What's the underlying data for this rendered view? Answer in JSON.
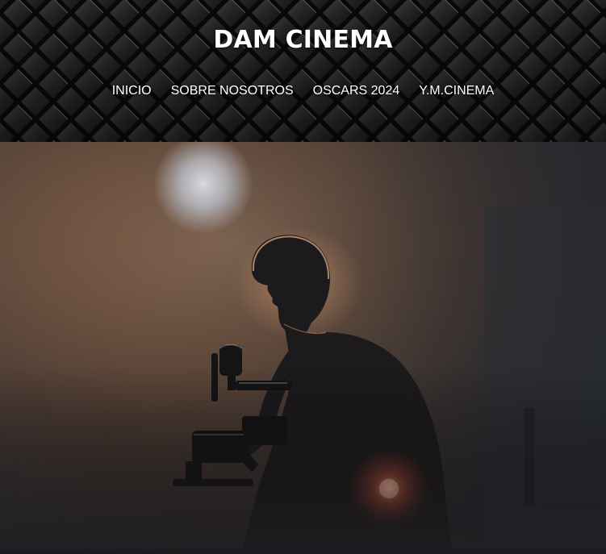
{
  "site": {
    "title": "DAM CINEMA"
  },
  "nav": {
    "items": [
      {
        "label": "INICIO"
      },
      {
        "label": "SOBRE NOSOTROS"
      },
      {
        "label": "OSCARS 2024"
      },
      {
        "label": "Y.M.CINEMA"
      }
    ]
  },
  "hero": {
    "image": "cameraman-silhouette-photo"
  },
  "colors": {
    "header_bg": "#0c0c0c",
    "nav_text": "#ffffff",
    "title_text": "#ffffff",
    "hero_warm": "#8a6a52",
    "hero_dark": "#2c2f35"
  }
}
